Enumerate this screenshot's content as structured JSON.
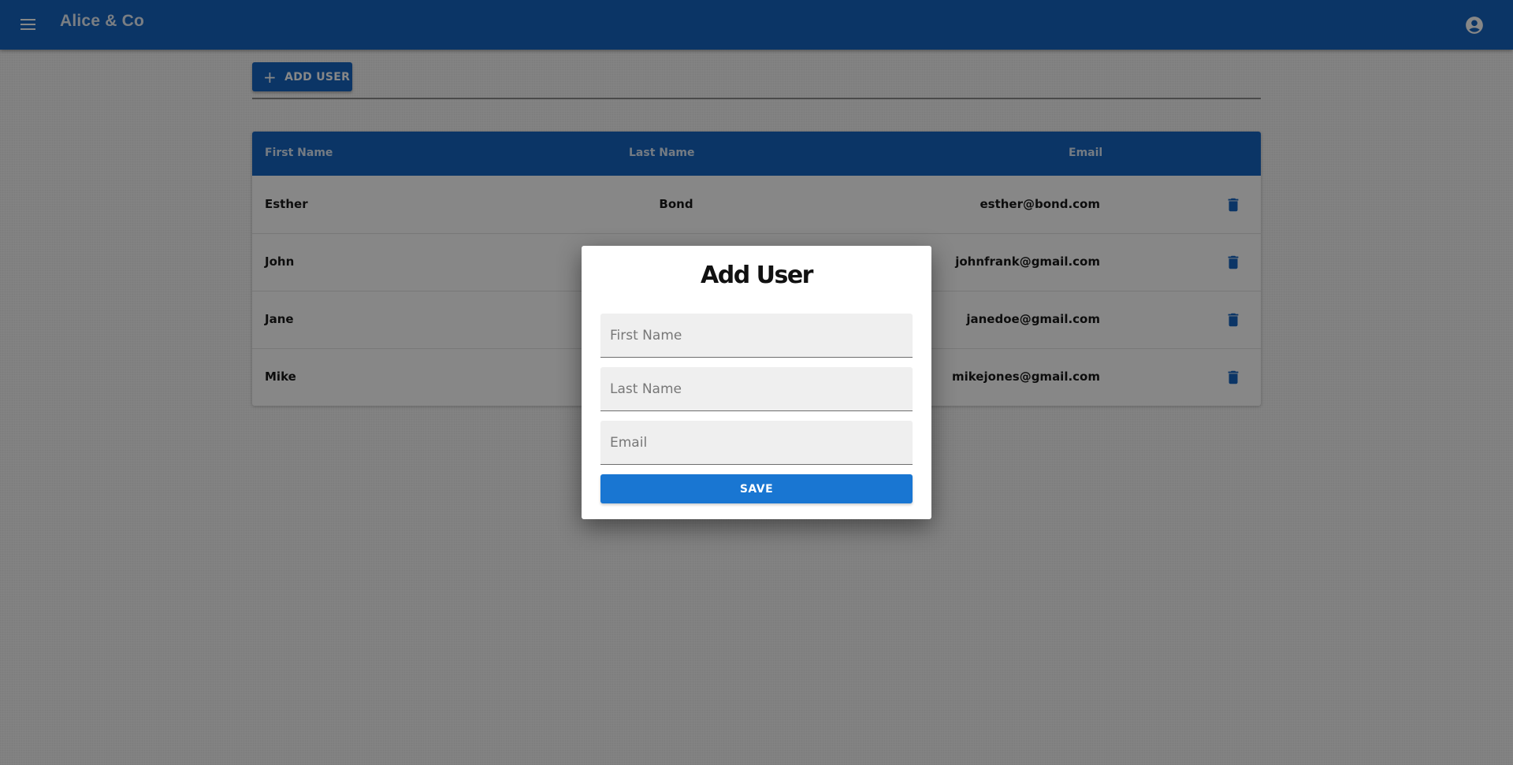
{
  "app": {
    "title": "Alice & Co",
    "menu_icon": "menu-icon",
    "account_icon": "account-circle-icon"
  },
  "toolbar": {
    "add_user_label": "ADD USER",
    "add_icon": "plus-icon"
  },
  "table": {
    "columns": [
      "First Name",
      "Last Name",
      "Email"
    ],
    "rows": [
      {
        "first": "Esther",
        "last": "Bond",
        "email": "esther@bond.com"
      },
      {
        "first": "John",
        "last": "",
        "email": "johnfrank@gmail.com"
      },
      {
        "first": "Jane",
        "last": "",
        "email": "janedoe@gmail.com"
      },
      {
        "first": "Mike",
        "last": "",
        "email": "mikejones@gmail.com"
      }
    ],
    "row_action_icon": "trash-icon"
  },
  "dialog": {
    "title": "Add User",
    "fields": [
      {
        "placeholder": "First Name",
        "value": ""
      },
      {
        "placeholder": "Last Name",
        "value": ""
      },
      {
        "placeholder": "Email",
        "value": ""
      }
    ],
    "save_label": "SAVE"
  },
  "colors": {
    "primary": "#1565c0",
    "save_button": "#1976d2",
    "overlay": "rgba(0,0,0,0.47)"
  }
}
